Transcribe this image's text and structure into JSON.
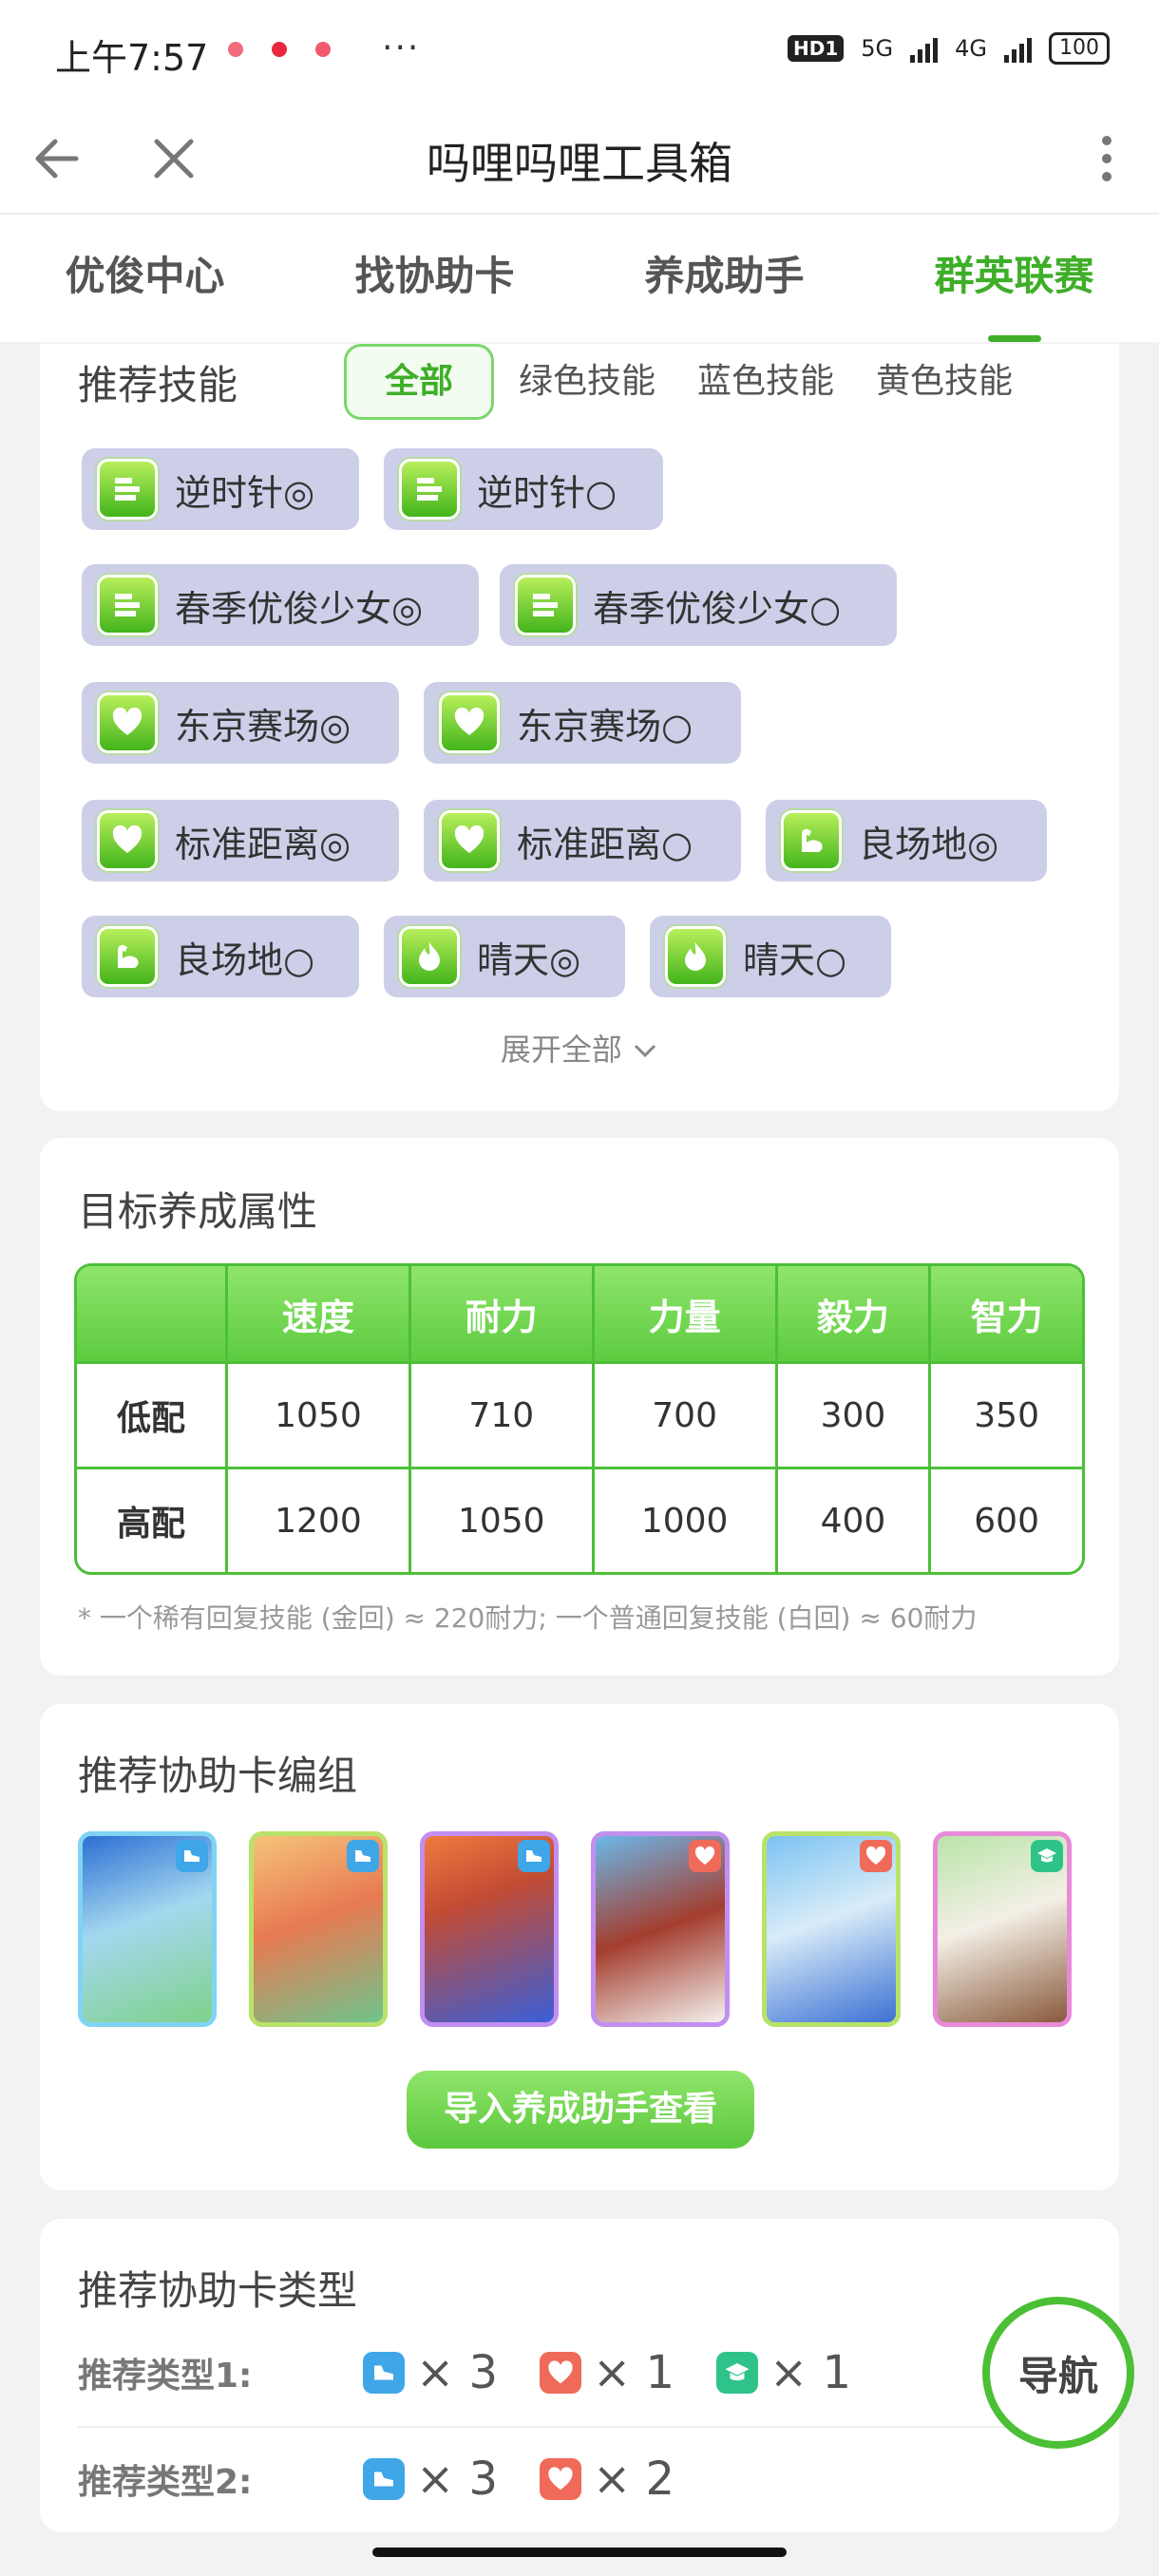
{
  "status_bar": {
    "time": "上午7:57",
    "more": "···",
    "hd": "HD1",
    "net1": "5G",
    "net2": "4G",
    "battery": "100"
  },
  "titlebar": {
    "title": "吗哩吗哩工具箱",
    "back_icon": "back-arrow-icon",
    "close_icon": "close-icon",
    "more_icon": "vertical-dots-icon"
  },
  "tabs": [
    {
      "label": "优俊中心",
      "active": false
    },
    {
      "label": "找协助卡",
      "active": false
    },
    {
      "label": "养成助手",
      "active": false
    },
    {
      "label": "群英联赛",
      "active": true
    }
  ],
  "skills": {
    "title": "推荐技能",
    "filters": [
      "全部",
      "绿色技能",
      "蓝色技能",
      "黄色技能"
    ],
    "active_filter": "全部",
    "chips": [
      {
        "icon": "speed-icon",
        "label": "逆时针◎"
      },
      {
        "icon": "speed-icon",
        "label": "逆时针○"
      },
      {
        "icon": "speed-icon",
        "label": "春季优俊少女◎"
      },
      {
        "icon": "speed-icon",
        "label": "春季优俊少女○"
      },
      {
        "icon": "heart-icon",
        "label": "东京赛场◎"
      },
      {
        "icon": "heart-icon",
        "label": "东京赛场○"
      },
      {
        "icon": "heart-icon",
        "label": "标准距离◎"
      },
      {
        "icon": "heart-icon",
        "label": "标准距离○"
      },
      {
        "icon": "muscle-icon",
        "label": "良场地◎"
      },
      {
        "icon": "muscle-icon",
        "label": "良场地○"
      },
      {
        "icon": "flame-icon",
        "label": "晴天◎"
      },
      {
        "icon": "flame-icon",
        "label": "晴天○"
      }
    ],
    "expand_label": "展开全部"
  },
  "attributes": {
    "title": "目标养成属性",
    "columns": [
      "",
      "速度",
      "耐力",
      "力量",
      "毅力",
      "智力"
    ],
    "rows": [
      [
        "低配",
        "1050",
        "710",
        "700",
        "300",
        "350"
      ],
      [
        "高配",
        "1200",
        "1050",
        "1000",
        "400",
        "600"
      ]
    ],
    "note": "* 一个稀有回复技能 (金回) ≈ 220耐力; 一个普通回复技能 (白回) ≈ 60耐力"
  },
  "support_cards": {
    "title": "推荐协助卡编组",
    "cards": [
      {
        "type": "speed",
        "badge_icon": "speed-shoe-icon",
        "frame": "#7fd4f3",
        "bg1": "#2c6fd4",
        "bg2": "#7fd18a"
      },
      {
        "type": "speed",
        "badge_icon": "speed-shoe-icon",
        "frame": "#b8e26a",
        "bg1": "#e87a52",
        "bg2": "#6fc48c"
      },
      {
        "type": "speed",
        "badge_icon": "speed-shoe-icon",
        "frame": "#c28ff0",
        "bg1": "#3a5fd9",
        "bg2": "#f07a3e"
      },
      {
        "type": "stamina",
        "badge_icon": "heart-icon",
        "frame": "#c28ff0",
        "bg1": "#6ab7ea",
        "bg2": "#a43e2f"
      },
      {
        "type": "stamina",
        "badge_icon": "heart-icon",
        "frame": "#b8e26a",
        "bg1": "#7cc3f2",
        "bg2": "#3c71d4"
      },
      {
        "type": "wisdom",
        "badge_icon": "graduation-cap-icon",
        "frame": "#e98ad9",
        "bg1": "#b9e5a8",
        "bg2": "#8a5a3c"
      }
    ],
    "import_button": "导入养成助手查看"
  },
  "support_types": {
    "title": "推荐协助卡类型",
    "rows": [
      {
        "label": "推荐类型1:",
        "items": [
          {
            "icon": "speed-shoe-icon",
            "color": "#3fa6e8",
            "count": "× 3"
          },
          {
            "icon": "heart-icon",
            "color": "#f06a5a",
            "count": "× 1"
          },
          {
            "icon": "graduation-cap-icon",
            "color": "#2fc38a",
            "count": "× 1"
          }
        ]
      },
      {
        "label": "推荐类型2:",
        "items": [
          {
            "icon": "speed-shoe-icon",
            "color": "#3fa6e8",
            "count": "× 3"
          },
          {
            "icon": "heart-icon",
            "color": "#f06a5a",
            "count": "× 2"
          }
        ]
      }
    ]
  },
  "nav_button": "导航",
  "colors": {
    "accent": "#3fae29",
    "chip_bg": "#cdcfe8"
  }
}
